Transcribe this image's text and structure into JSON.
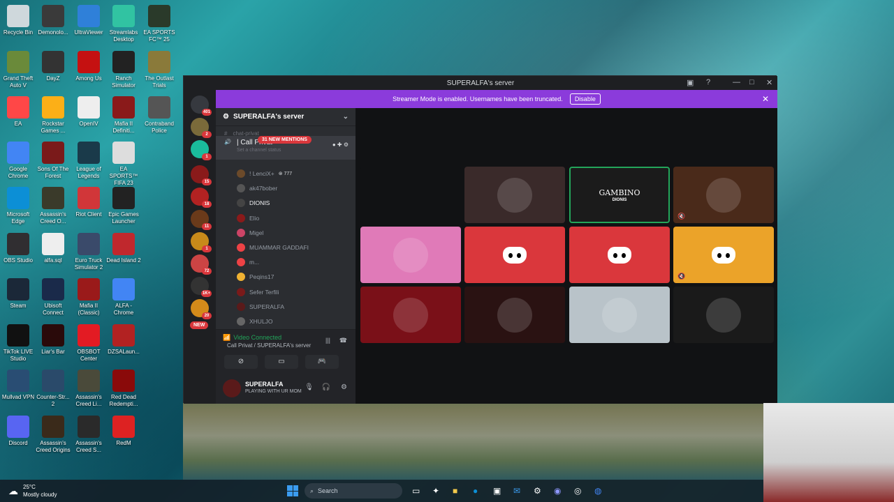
{
  "desktop": {
    "icons": [
      {
        "label": "Recycle Bin",
        "icon": "recycle-bin-icon",
        "color": "#cfd8dc"
      },
      {
        "label": "Demonolo...",
        "icon": "demonologist-icon",
        "color": "#3a3a3a"
      },
      {
        "label": "UltraViewer",
        "icon": "ultraviewer-icon",
        "color": "#2f80d9"
      },
      {
        "label": "Streamlabs Desktop",
        "icon": "streamlabs-icon",
        "color": "#31c3a2"
      },
      {
        "label": "EA SPORTS FC™ 25",
        "icon": "eafc-icon",
        "color": "#2a3a2a"
      },
      {
        "label": "Grand Theft Auto V",
        "icon": "gta-icon",
        "color": "#6a8a3a"
      },
      {
        "label": "DayZ",
        "icon": "dayz-icon",
        "color": "#333"
      },
      {
        "label": "Among Us",
        "icon": "among-us-icon",
        "color": "#c51111"
      },
      {
        "label": "Ranch Simulator",
        "icon": "ranch-icon",
        "color": "#222"
      },
      {
        "label": "The Outlast Trials",
        "icon": "outlast-icon",
        "color": "#8a7a3a"
      },
      {
        "label": "EA",
        "icon": "ea-icon",
        "color": "#ff4747"
      },
      {
        "label": "Rockstar Games ...",
        "icon": "rockstar-icon",
        "color": "#fcaf17"
      },
      {
        "label": "OpenIV",
        "icon": "openiv-icon",
        "color": "#eee"
      },
      {
        "label": "Mafia II Definiti...",
        "icon": "mafia-icon",
        "color": "#8a1a1a"
      },
      {
        "label": "Contraband Police",
        "icon": "contraband-icon",
        "color": "#555"
      },
      {
        "label": "Google Chrome",
        "icon": "chrome-icon",
        "color": "#4285f4"
      },
      {
        "label": "Sons Of The Forest",
        "icon": "sotf-icon",
        "color": "#7a1a1a"
      },
      {
        "label": "League of Legends",
        "icon": "lol-icon",
        "color": "#1a3a4a"
      },
      {
        "label": "EA SPORTS™ FIFA 23",
        "icon": "fifa-icon",
        "color": "#ddd"
      },
      {
        "label": "Microsoft Edge",
        "icon": "edge-icon",
        "color": "#0c8fd6"
      },
      {
        "label": "Assassin's Creed O...",
        "icon": "ac-icon",
        "color": "#3a3a2a"
      },
      {
        "label": "Riot Client",
        "icon": "riot-icon",
        "color": "#d13639"
      },
      {
        "label": "Epic Games Launcher",
        "icon": "epic-icon",
        "color": "#222"
      },
      {
        "label": "OBS Studio",
        "icon": "obs-icon",
        "color": "#302e31"
      },
      {
        "label": "alfa.sql",
        "icon": "file-icon",
        "color": "#eee"
      },
      {
        "label": "Euro Truck Simulator 2",
        "icon": "ets2-icon",
        "color": "#3a4a6a"
      },
      {
        "label": "Dead Island 2",
        "icon": "dead-island-icon",
        "color": "#c0282d"
      },
      {
        "label": "Steam",
        "icon": "steam-icon",
        "color": "#1b2838"
      },
      {
        "label": "Ubisoft Connect",
        "icon": "ubisoft-icon",
        "color": "#1a2a4a"
      },
      {
        "label": "Mafia II (Classic)",
        "icon": "mafia-classic-icon",
        "color": "#9a1a1a"
      },
      {
        "label": "ALFA - Chrome",
        "icon": "chrome-profile-icon",
        "color": "#4285f4"
      },
      {
        "label": "TikTok LIVE Studio",
        "icon": "tiktok-icon",
        "color": "#111"
      },
      {
        "label": "Liar's Bar",
        "icon": "liars-bar-icon",
        "color": "#2a0a0a"
      },
      {
        "label": "OBSBOT Center",
        "icon": "obsbot-icon",
        "color": "#e31b23"
      },
      {
        "label": "DZSALaun...",
        "icon": "dzsa-icon",
        "color": "#b22222"
      },
      {
        "label": "Mullvad VPN",
        "icon": "mullvad-icon",
        "color": "#294d73"
      },
      {
        "label": "Counter-Str... 2",
        "icon": "cs2-icon",
        "color": "#2a4a6a"
      },
      {
        "label": "Assassin's Creed Li...",
        "icon": "ac-liberation-icon",
        "color": "#4a4a3a"
      },
      {
        "label": "Red Dead Redempti...",
        "icon": "rdr-icon",
        "color": "#8a0a0a"
      },
      {
        "label": "Discord",
        "icon": "discord-icon",
        "color": "#5865f2"
      },
      {
        "label": "Assassin's Creed Origins",
        "icon": "ac-origins-icon",
        "color": "#3a2a1a"
      },
      {
        "label": "Assassin's Creed S...",
        "icon": "ac-syndicate-icon",
        "color": "#2a2a2a"
      },
      {
        "label": "RedM",
        "icon": "redm-icon",
        "color": "#d22"
      }
    ]
  },
  "window": {
    "title": "SUPERALFA's server"
  },
  "banner": {
    "text": "Streamer Mode is enabled. Usernames have been truncated.",
    "button": "Disable",
    "color": "#8b3bdb"
  },
  "guilds": {
    "badges": [
      "401",
      "2",
      "1",
      "15",
      "18",
      "11",
      "1",
      "72",
      "1K+",
      "20"
    ],
    "new_label": "NEW"
  },
  "sidebar": {
    "server_name": "SUPERALFA's server",
    "channel_above": "chat-privat",
    "voice_channel": "| Call Privat",
    "mentions_pill": "31 NEW MENTIONS",
    "status_placeholder": "Set a channel status",
    "members": [
      {
        "name": "! LenciX+",
        "extra": "777",
        "color": "#6b4a2a"
      },
      {
        "name": "ak47bober",
        "color": "#555"
      },
      {
        "name": "DIONIS",
        "color": "#444",
        "active": true
      },
      {
        "name": "Elio",
        "color": "#8a1a1a"
      },
      {
        "name": "Migel",
        "color": "#c46"
      },
      {
        "name": "MUAMMAR GADDAFI",
        "color": "#ed4245"
      },
      {
        "name": "m...",
        "color": "#ed4245"
      },
      {
        "name": "Peqins17",
        "color": "#f0b232"
      },
      {
        "name": "Sefer Terfili",
        "color": "#7a1a1a"
      },
      {
        "name": "SUPERALFA",
        "color": "#5a1a1a"
      },
      {
        "name": "XHULJO",
        "color": "#666"
      }
    ]
  },
  "voice": {
    "status": "Video Connected",
    "channel": "Call Privat / SUPERALFA's server"
  },
  "user": {
    "name": "SUPERALFA",
    "status": "PLAYING WITH UR MOM"
  },
  "stage": {
    "tiles": [
      {
        "kind": "blank",
        "color": "#111214"
      },
      {
        "kind": "avatar",
        "color": "#3a2a2a"
      },
      {
        "kind": "text",
        "color": "#1b1b1b",
        "title": "GAMBINO",
        "subtitle": "DIONIS",
        "speaking": true
      },
      {
        "kind": "avatar",
        "color": "#4a2a1a",
        "muted": true
      },
      {
        "kind": "avatar",
        "color": "#e07ab8"
      },
      {
        "kind": "discord",
        "color": "#da373c"
      },
      {
        "kind": "discord",
        "color": "#da373c"
      },
      {
        "kind": "discord",
        "color": "#eba329",
        "muted": true
      },
      {
        "kind": "avatar",
        "color": "#7a1018"
      },
      {
        "kind": "avatar",
        "color": "#2a1212"
      },
      {
        "kind": "avatar",
        "color": "#b9c3c9"
      },
      {
        "kind": "avatar",
        "color": "#1a1a1a"
      }
    ]
  },
  "taskbar": {
    "weather_temp": "25°C",
    "weather_desc": "Mostly cloudy",
    "search_placeholder": "Search"
  }
}
